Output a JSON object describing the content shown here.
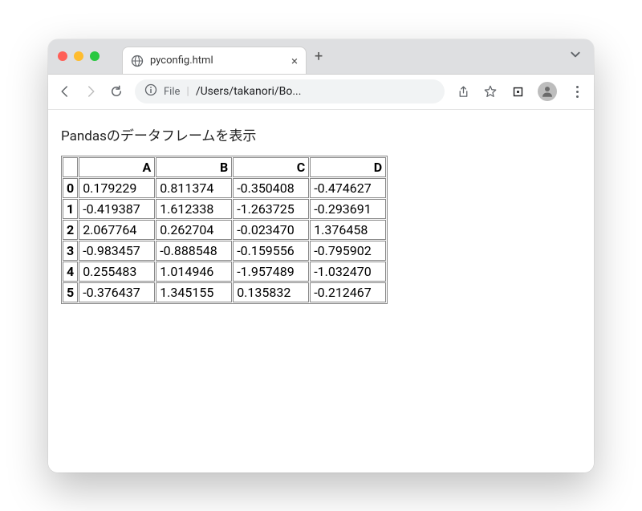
{
  "tab": {
    "title": "pyconfig.html"
  },
  "omnibox": {
    "scheme_label": "File",
    "path": "/Users/takanori/Bo..."
  },
  "page": {
    "heading": "Pandasのデータフレームを表示"
  },
  "chart_data": {
    "type": "table",
    "columns": [
      "A",
      "B",
      "C",
      "D"
    ],
    "index": [
      "0",
      "1",
      "2",
      "3",
      "4",
      "5"
    ],
    "rows": [
      [
        "0.179229",
        "0.811374",
        "-0.350408",
        "-0.474627"
      ],
      [
        "-0.419387",
        "1.612338",
        "-1.263725",
        "-0.293691"
      ],
      [
        "2.067764",
        "0.262704",
        "-0.023470",
        "1.376458"
      ],
      [
        "-0.983457",
        "-0.888548",
        "-0.159556",
        "-0.795902"
      ],
      [
        "0.255483",
        "1.014946",
        "-1.957489",
        "-1.032470"
      ],
      [
        "-0.376437",
        "1.345155",
        "0.135832",
        "-0.212467"
      ]
    ]
  }
}
